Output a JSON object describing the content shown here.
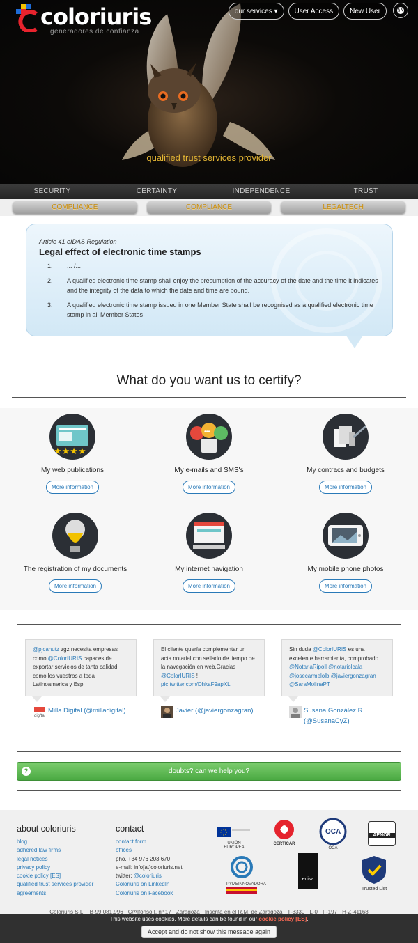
{
  "header": {
    "logo_text": "coloriuris",
    "logo_sub": "generadores de confianza",
    "nav": {
      "services": "our services ▾",
      "user_access": "User Access",
      "new_user": "New User"
    },
    "tagline": "qualified trust services provider"
  },
  "values_strip": [
    "SECURITY",
    "CERTAINTY",
    "INDEPENDENCE",
    "TRUST"
  ],
  "compliance_buttons": [
    "COMPLIANCE",
    "COMPLIANCE",
    "LEGALTECH"
  ],
  "quote": {
    "subtitle": "Article 41 eIDAS Regulation",
    "title": "Legal effect of electronic time stamps",
    "items": [
      "... /...",
      "A qualified electronic time stamp shall enjoy the presumption of the accuracy of the date and the time it indicates and the integrity of the data to which the date and time are bound.",
      "A qualified electronic time stamp issued in one Member State shall be recognised as a qualified electronic time stamp in all Member States"
    ]
  },
  "certify": {
    "title": "What do you want us to certify?",
    "more_label": "More information",
    "services": [
      "My web publications",
      "My e-mails and SMS's",
      "My contracs and budgets",
      "The registration of my documents",
      "My internet navigation",
      "My mobile phone photos"
    ]
  },
  "tweets": [
    {
      "pre": "@pjcanutz",
      "body": " zgz necesita empresas como ",
      "mention": "@ColorIURIS",
      "rest": " capaces de exportar servicios de tanta calidad como los vuestros a toda Latinoamerica y Esp",
      "author": "Milla Digital (@milladigital)"
    },
    {
      "body": "El cliente quería complementar un acta notarial con sellado de tiempo de la navegación en web.Gracias ",
      "mention": "@ColorIURIS",
      "rest": " ! ",
      "link": "pic.twitter.com/DhkaF9apXL",
      "author": "Javier (@javiergonzagran)"
    },
    {
      "body": "Sin duda ",
      "mention": "@ColorIURIS",
      "rest": " es una excelente herramienta, comprobado ",
      "mentions2": "@NotariaRipoll @notariolcala @josecarmelolb @javiergonzagran @SaraMolinaPT",
      "author": "Susana González R (@SusanaCyZ)"
    }
  ],
  "help_bar": "doubts? can we help you?",
  "footer": {
    "about_title": "about coloriuris",
    "about_links": [
      "blog",
      "adhered law firms",
      "legal notices",
      "privacy policy",
      "cookie policy [ES]",
      "qualified trust services provider",
      "agreements"
    ],
    "contact_title": "contact",
    "contact_links": [
      "contact form",
      "offices"
    ],
    "phone": "pho. +34 976 203 670",
    "email": "e-mail: info[at]coloriuris.net",
    "twitter_prefix": "twitter: ",
    "twitter_handle": "@coloriuris",
    "linkedin": "Coloriuris on LinkedIn",
    "facebook": "Coloriuris on Facebook",
    "badges": {
      "eu": "UNIÓN EUROPEA",
      "certicar": "CERTICAR",
      "oca": "OCA",
      "aenor": "AENOR",
      "pyme": "PYMEINNOVADORA",
      "enisa": "enisa",
      "trusted": "Trusted List"
    }
  },
  "legal_line": "Coloriuris S.L. · B-99.081.996 · C/Alfonso I, nº 17 · Zaragoza · Inscrita en el R.M. de Zaragoza · T-3330 · L-0 · F-197 · H-Z-41168",
  "cookie": {
    "message": "This website uses cookies. More details can be found in our ",
    "link": "cookie policy [ES]",
    "end": ".",
    "accept": "Accept and do not show this message again"
  },
  "colors": {
    "link": "#2a7ab8",
    "gold": "#e3b534",
    "help_green": "#4aa942"
  }
}
